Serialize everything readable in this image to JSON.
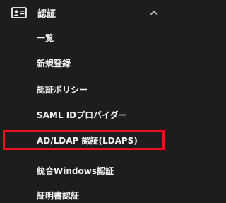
{
  "section": {
    "title": "認証",
    "icon": "id-card-icon",
    "expanded_icon": "chevron-up-icon"
  },
  "menu": {
    "items": [
      {
        "label": "一覧"
      },
      {
        "label": "新規登録"
      },
      {
        "label": "認証ポリシー"
      },
      {
        "label": "SAML IDプロバイダー"
      },
      {
        "label": "AD/LDAP 認証(LDAPS)",
        "selected": true
      },
      {
        "label": "統合Windows認証"
      },
      {
        "label": "証明書認証"
      }
    ]
  },
  "colors": {
    "background": "#1d1d1d",
    "text": "#f2f2f2",
    "highlight_border": "#e5141a"
  }
}
